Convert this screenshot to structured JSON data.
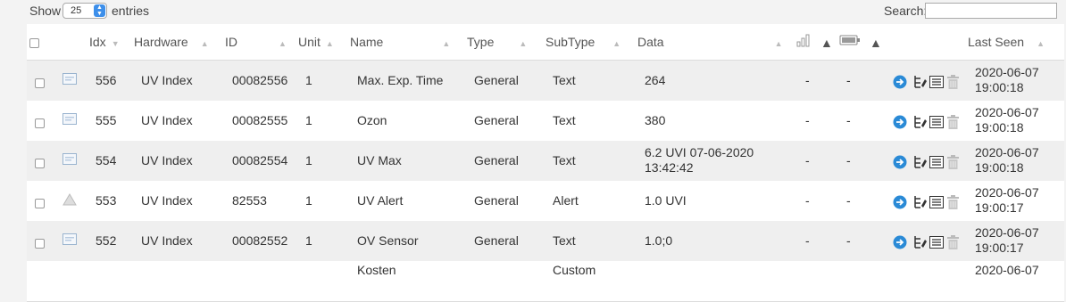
{
  "controls": {
    "show_label": "Show",
    "entries_value": "25",
    "entries_label": "entries",
    "search_label": "Search:",
    "search_value": ""
  },
  "columns": {
    "idx": "Idx",
    "hardware": "Hardware",
    "id": "ID",
    "unit": "Unit",
    "name": "Name",
    "type": "Type",
    "subtype": "SubType",
    "data": "Data",
    "last_seen": "Last Seen"
  },
  "header_icons": [
    "signal-icon",
    "battery-icon"
  ],
  "rows": [
    {
      "icon": "text-device-icon",
      "idx": "556",
      "hardware": "UV Index",
      "id": "00082556",
      "unit": "1",
      "name": "Max. Exp. Time",
      "type": "General",
      "subtype": "Text",
      "data_lines": [
        "264",
        ""
      ],
      "signal": "-",
      "battery": "-",
      "last_seen_date": "2020-06-07",
      "last_seen_time": "19:00:18"
    },
    {
      "icon": "text-device-icon",
      "idx": "555",
      "hardware": "UV Index",
      "id": "00082555",
      "unit": "1",
      "name": "Ozon",
      "type": "General",
      "subtype": "Text",
      "data_lines": [
        "380",
        ""
      ],
      "signal": "-",
      "battery": "-",
      "last_seen_date": "2020-06-07",
      "last_seen_time": "19:00:18"
    },
    {
      "icon": "text-device-icon",
      "idx": "554",
      "hardware": "UV Index",
      "id": "00082554",
      "unit": "1",
      "name": "UV Max",
      "type": "General",
      "subtype": "Text",
      "data_lines": [
        "6.2 UVI 07-06-2020",
        "13:42:42"
      ],
      "signal": "-",
      "battery": "-",
      "last_seen_date": "2020-06-07",
      "last_seen_time": "19:00:18"
    },
    {
      "icon": "alert-triangle-icon",
      "idx": "553",
      "hardware": "UV Index",
      "id": "82553",
      "unit": "1",
      "name": "UV Alert",
      "type": "General",
      "subtype": "Alert",
      "data_lines": [
        "1.0 UVI",
        ""
      ],
      "signal": "-",
      "battery": "-",
      "last_seen_date": "2020-06-07",
      "last_seen_time": "19:00:17"
    },
    {
      "icon": "text-device-icon",
      "idx": "552",
      "hardware": "UV Index",
      "id": "00082552",
      "unit": "1",
      "name": "OV Sensor",
      "type": "General",
      "subtype": "Text",
      "data_lines": [
        "1.0;0",
        ""
      ],
      "signal": "-",
      "battery": "-",
      "last_seen_date": "2020-06-07",
      "last_seen_time": "19:00:17"
    }
  ],
  "partial_row": {
    "name": "Kosten",
    "subtype": "Custom",
    "last_seen_date": "2020-06-07"
  },
  "colors": {
    "accent": "#3d8fea",
    "row_alt": "#efefef",
    "border": "#dddddd"
  }
}
